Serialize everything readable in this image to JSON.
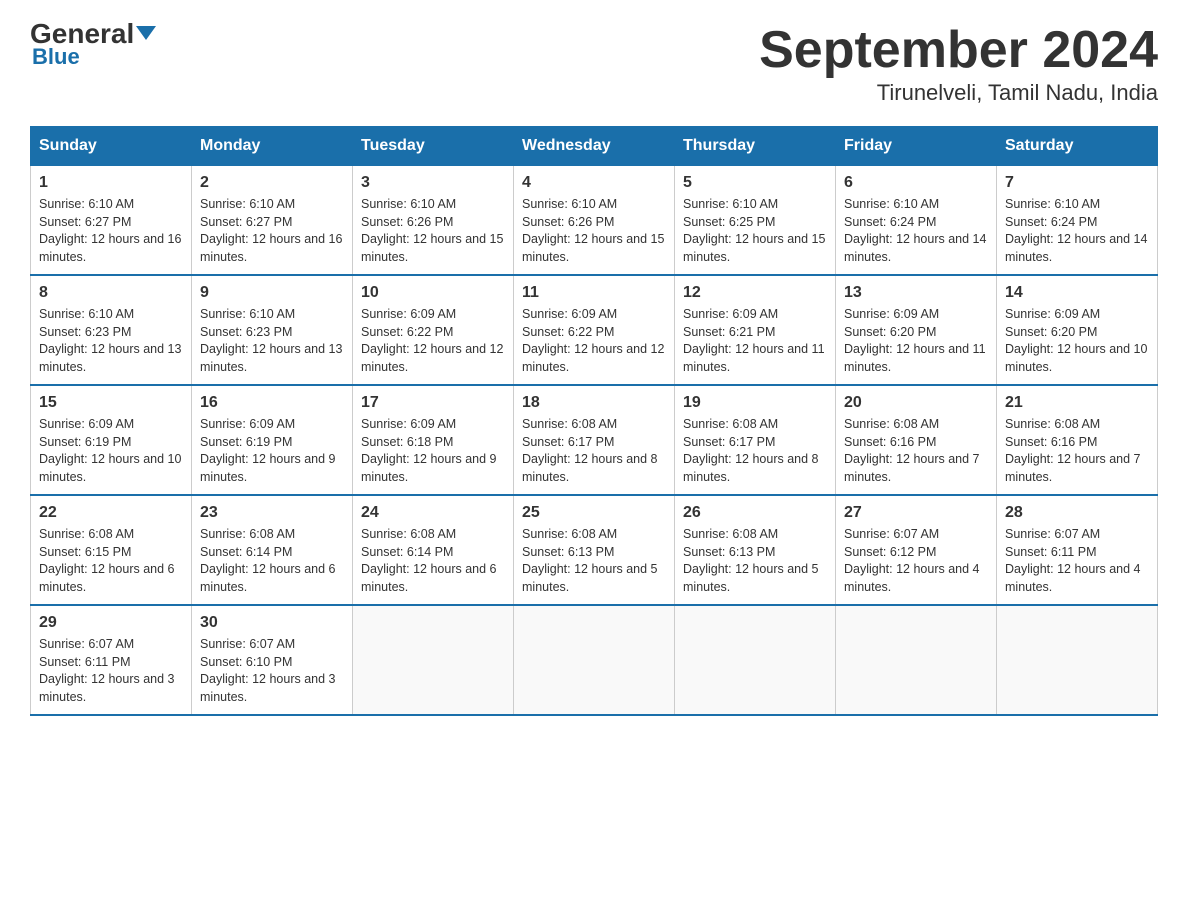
{
  "header": {
    "logo_top": "General",
    "logo_bottom": "Blue",
    "title": "September 2024",
    "subtitle": "Tirunelveli, Tamil Nadu, India"
  },
  "days_of_week": [
    "Sunday",
    "Monday",
    "Tuesday",
    "Wednesday",
    "Thursday",
    "Friday",
    "Saturday"
  ],
  "weeks": [
    [
      {
        "num": "1",
        "sunrise": "6:10 AM",
        "sunset": "6:27 PM",
        "daylight": "12 hours and 16 minutes."
      },
      {
        "num": "2",
        "sunrise": "6:10 AM",
        "sunset": "6:27 PM",
        "daylight": "12 hours and 16 minutes."
      },
      {
        "num": "3",
        "sunrise": "6:10 AM",
        "sunset": "6:26 PM",
        "daylight": "12 hours and 15 minutes."
      },
      {
        "num": "4",
        "sunrise": "6:10 AM",
        "sunset": "6:26 PM",
        "daylight": "12 hours and 15 minutes."
      },
      {
        "num": "5",
        "sunrise": "6:10 AM",
        "sunset": "6:25 PM",
        "daylight": "12 hours and 15 minutes."
      },
      {
        "num": "6",
        "sunrise": "6:10 AM",
        "sunset": "6:24 PM",
        "daylight": "12 hours and 14 minutes."
      },
      {
        "num": "7",
        "sunrise": "6:10 AM",
        "sunset": "6:24 PM",
        "daylight": "12 hours and 14 minutes."
      }
    ],
    [
      {
        "num": "8",
        "sunrise": "6:10 AM",
        "sunset": "6:23 PM",
        "daylight": "12 hours and 13 minutes."
      },
      {
        "num": "9",
        "sunrise": "6:10 AM",
        "sunset": "6:23 PM",
        "daylight": "12 hours and 13 minutes."
      },
      {
        "num": "10",
        "sunrise": "6:09 AM",
        "sunset": "6:22 PM",
        "daylight": "12 hours and 12 minutes."
      },
      {
        "num": "11",
        "sunrise": "6:09 AM",
        "sunset": "6:22 PM",
        "daylight": "12 hours and 12 minutes."
      },
      {
        "num": "12",
        "sunrise": "6:09 AM",
        "sunset": "6:21 PM",
        "daylight": "12 hours and 11 minutes."
      },
      {
        "num": "13",
        "sunrise": "6:09 AM",
        "sunset": "6:20 PM",
        "daylight": "12 hours and 11 minutes."
      },
      {
        "num": "14",
        "sunrise": "6:09 AM",
        "sunset": "6:20 PM",
        "daylight": "12 hours and 10 minutes."
      }
    ],
    [
      {
        "num": "15",
        "sunrise": "6:09 AM",
        "sunset": "6:19 PM",
        "daylight": "12 hours and 10 minutes."
      },
      {
        "num": "16",
        "sunrise": "6:09 AM",
        "sunset": "6:19 PM",
        "daylight": "12 hours and 9 minutes."
      },
      {
        "num": "17",
        "sunrise": "6:09 AM",
        "sunset": "6:18 PM",
        "daylight": "12 hours and 9 minutes."
      },
      {
        "num": "18",
        "sunrise": "6:08 AM",
        "sunset": "6:17 PM",
        "daylight": "12 hours and 8 minutes."
      },
      {
        "num": "19",
        "sunrise": "6:08 AM",
        "sunset": "6:17 PM",
        "daylight": "12 hours and 8 minutes."
      },
      {
        "num": "20",
        "sunrise": "6:08 AM",
        "sunset": "6:16 PM",
        "daylight": "12 hours and 7 minutes."
      },
      {
        "num": "21",
        "sunrise": "6:08 AM",
        "sunset": "6:16 PM",
        "daylight": "12 hours and 7 minutes."
      }
    ],
    [
      {
        "num": "22",
        "sunrise": "6:08 AM",
        "sunset": "6:15 PM",
        "daylight": "12 hours and 6 minutes."
      },
      {
        "num": "23",
        "sunrise": "6:08 AM",
        "sunset": "6:14 PM",
        "daylight": "12 hours and 6 minutes."
      },
      {
        "num": "24",
        "sunrise": "6:08 AM",
        "sunset": "6:14 PM",
        "daylight": "12 hours and 6 minutes."
      },
      {
        "num": "25",
        "sunrise": "6:08 AM",
        "sunset": "6:13 PM",
        "daylight": "12 hours and 5 minutes."
      },
      {
        "num": "26",
        "sunrise": "6:08 AM",
        "sunset": "6:13 PM",
        "daylight": "12 hours and 5 minutes."
      },
      {
        "num": "27",
        "sunrise": "6:07 AM",
        "sunset": "6:12 PM",
        "daylight": "12 hours and 4 minutes."
      },
      {
        "num": "28",
        "sunrise": "6:07 AM",
        "sunset": "6:11 PM",
        "daylight": "12 hours and 4 minutes."
      }
    ],
    [
      {
        "num": "29",
        "sunrise": "6:07 AM",
        "sunset": "6:11 PM",
        "daylight": "12 hours and 3 minutes."
      },
      {
        "num": "30",
        "sunrise": "6:07 AM",
        "sunset": "6:10 PM",
        "daylight": "12 hours and 3 minutes."
      },
      null,
      null,
      null,
      null,
      null
    ]
  ]
}
